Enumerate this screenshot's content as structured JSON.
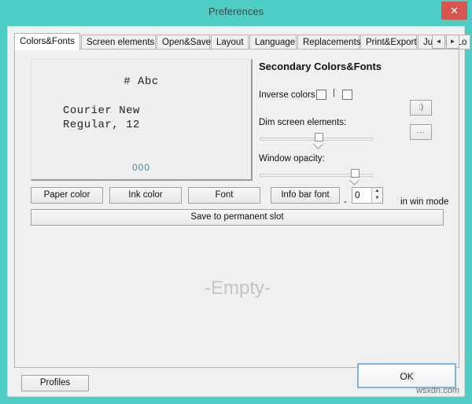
{
  "window": {
    "title": "Preferences",
    "close_label": "✕",
    "titlebar_color": "#4ecdc4",
    "close_button_color": "#d9534f"
  },
  "tabs": {
    "items": [
      {
        "label": "Colors&Fonts",
        "active": true
      },
      {
        "label": "Screen elements",
        "active": false
      },
      {
        "label": "Open&Save",
        "active": false
      },
      {
        "label": "Layout",
        "active": false
      },
      {
        "label": "Language",
        "active": false
      },
      {
        "label": "Replacements",
        "active": false
      },
      {
        "label": "Print&Export",
        "active": false
      },
      {
        "label": "Jumps",
        "active": false
      },
      {
        "label": "Lo",
        "active": false
      }
    ],
    "scroll_prev": "◄",
    "scroll_next": "►"
  },
  "preview": {
    "sample_glyphs": "#  Abc",
    "font_name": "Courier New",
    "font_style": "Regular, 12",
    "number_sample": "000",
    "number_color": "#3f8fa0",
    "paper_color": "#efefef",
    "ink_color": "#222222"
  },
  "secondary": {
    "heading": "Secondary Colors&Fonts",
    "inverse_colors_label": "Inverse colors",
    "inverse_separator": "|",
    "dim_label": "Dim screen elements:",
    "dim_value": 53,
    "opacity_label": "Window opacity:",
    "opacity_value": 87,
    "smiley_button": ":)",
    "dots_button": "..."
  },
  "buttons": {
    "paper_color": "Paper color",
    "ink_color": "Ink color",
    "font": "Font",
    "info_bar_font": "Info bar font",
    "save_permanent": "Save to permanent slot",
    "profiles": "Profiles",
    "ok": "OK"
  },
  "infobar": {
    "dash": "-",
    "spin_value": "0",
    "spin_up": "▲",
    "spin_down": "▼",
    "suffix_label": "in win mode"
  },
  "content": {
    "empty_placeholder": "-Empty-"
  },
  "watermark": "wsxdn.com"
}
